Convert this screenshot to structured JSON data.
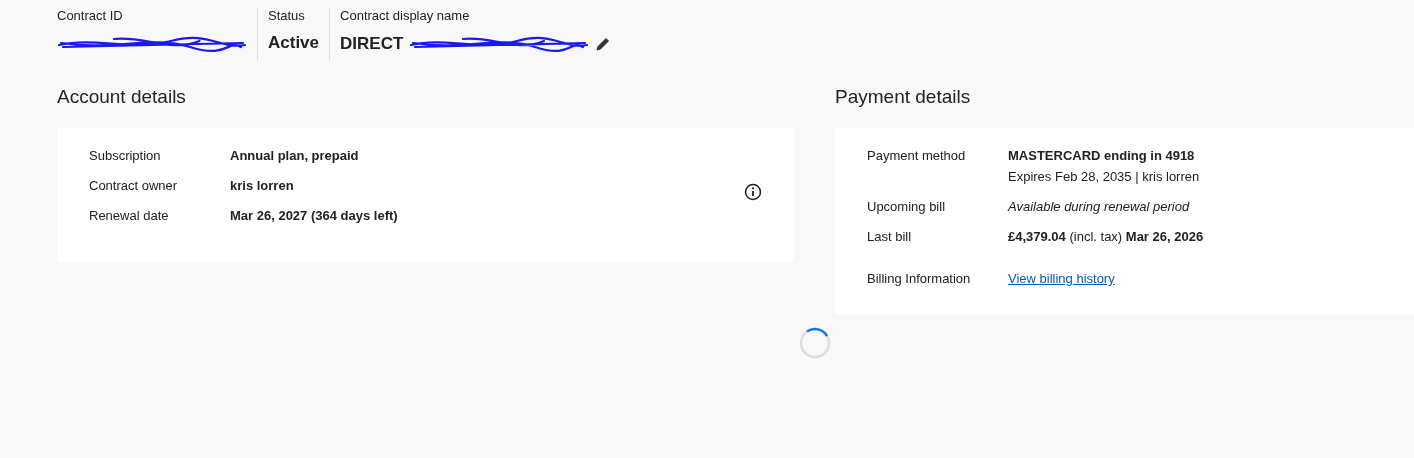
{
  "header": {
    "fields": [
      {
        "label": "Contract ID",
        "redacted": true,
        "editable": false
      },
      {
        "label": "Status",
        "value": "Active",
        "redacted": false,
        "editable": false
      },
      {
        "label": "Contract display name",
        "value": "DIRECT",
        "redacted": true,
        "editable": true
      }
    ]
  },
  "account_details": {
    "title": "Account details",
    "rows": [
      {
        "label": "Subscription",
        "value": "Annual plan, prepaid",
        "kind": "bold",
        "info_icon": false
      },
      {
        "label": "Contract owner",
        "value": "kris lorren",
        "kind": "bold",
        "info_icon": true
      },
      {
        "label": "Renewal date",
        "value": "Mar 26, 2027 (364 days left)",
        "kind": "bold",
        "info_icon": false
      }
    ]
  },
  "payment_details": {
    "title": "Payment details",
    "rows": [
      {
        "label": "Payment method",
        "value": "MASTERCARD ending in 4918",
        "kind": "bold",
        "subvalue": "Expires Feb 28, 2035 | kris lorren"
      },
      {
        "label": "Upcoming bill",
        "value": "Available during renewal period",
        "kind": "italic"
      },
      {
        "label": "Last bill",
        "value": "**£4,379.04**  (incl. tax) **Mar 26, 2026**",
        "kind": "rich"
      },
      {
        "label": "Billing Information",
        "value": "View billing history",
        "kind": "link"
      }
    ]
  },
  "loading": true
}
